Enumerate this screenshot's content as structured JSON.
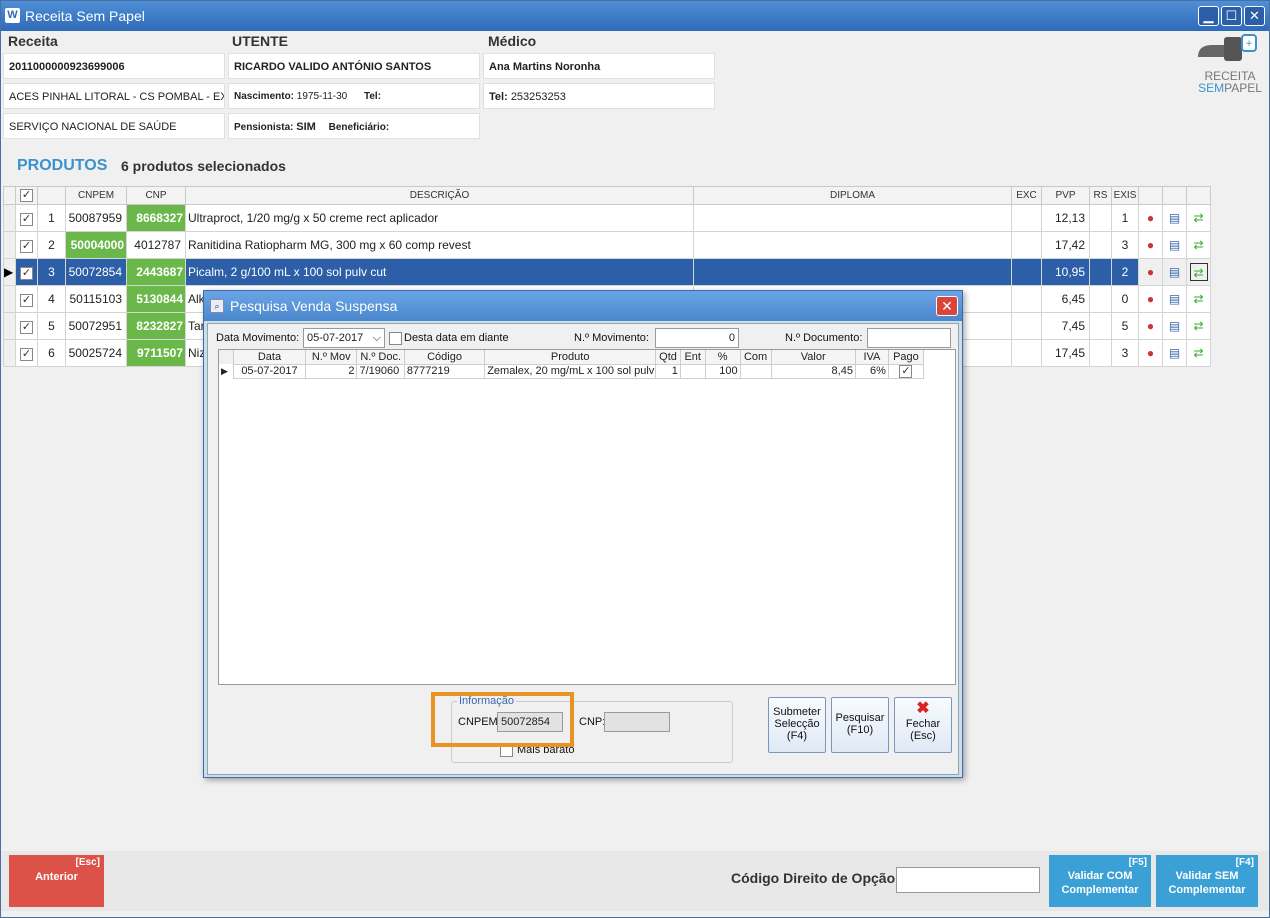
{
  "app": {
    "title": "Receita Sem Papel",
    "icon_letter": "W",
    "window_buttons": {
      "minimize": "▁",
      "maximize": "☐",
      "close": "✕"
    }
  },
  "header": {
    "receita": {
      "label": "Receita",
      "numero": "2011000000923699006",
      "local": "ACES PINHAL LITORAL - CS POMBAL - EXT",
      "entidade": "SERVIÇO NACIONAL DE SAÚDE"
    },
    "utente": {
      "label": "UTENTE",
      "nome": "RICARDO VALIDO ANTÓNIO SANTOS",
      "nascimento_label": "Nascimento:",
      "nascimento": "1975-11-30",
      "tel_label": "Tel:",
      "tel": "",
      "pensionista_label": "Pensionista:",
      "pensionista": "SIM",
      "beneficiario_label": "Beneficiário:",
      "beneficiario": ""
    },
    "medico": {
      "label": "Médico",
      "nome": "Ana Martins Noronha",
      "tel_label": "Tel:",
      "tel": "253253253"
    },
    "logo": {
      "line1": "RECEITA",
      "line2a": "SEM",
      "line2b": "PAPEL"
    }
  },
  "produtos": {
    "title": "PRODUTOS",
    "count_text": "6 produtos selecionados",
    "columns": {
      "cnpem": "CNPEM",
      "cnp": "CNP",
      "descricao": "DESCRIÇÃO",
      "diploma": "DIPLOMA",
      "exc": "EXC",
      "pvp": "PVP",
      "rs": "RS",
      "exis": "EXIS"
    },
    "rows": [
      {
        "n": "1",
        "cnpem": "50087959",
        "cnp": "8668327",
        "descricao": "Ultraproct, 1/20 mg/g x 50 creme rect aplicador",
        "pvp": "12,13",
        "exis": "1"
      },
      {
        "n": "2",
        "cnpem": "50004000",
        "cnp": "4012787",
        "descricao": "Ranitidina Ratiopharm MG, 300 mg x 60 comp revest",
        "pvp": "17,42",
        "exis": "3"
      },
      {
        "n": "3",
        "cnpem": "50072854",
        "cnp": "2443687",
        "descricao": "Picalm, 2 g/100 mL x 100 sol pulv cut",
        "pvp": "10,95",
        "exis": "2"
      },
      {
        "n": "4",
        "cnpem": "50115103",
        "cnp": "5130844",
        "descricao": "Alk",
        "pvp": "6,45",
        "exis": "0"
      },
      {
        "n": "5",
        "cnpem": "50072951",
        "cnp": "8232827",
        "descricao": "Tar",
        "pvp": "7,45",
        "exis": "5"
      },
      {
        "n": "6",
        "cnpem": "50025724",
        "cnp": "9711507",
        "descricao": "Niz",
        "pvp": "17,45",
        "exis": "3"
      }
    ]
  },
  "dialog": {
    "title": "Pesquisa Venda Suspensa",
    "data_movimento_label": "Data Movimento:",
    "data_movimento": "05-07-2017",
    "desta_data_label": "Desta data em diante",
    "n_movimento_label": "N.º Movimento:",
    "n_movimento": "0",
    "n_documento_label": "N.º Documento:",
    "n_documento": "",
    "grid": {
      "columns": {
        "data": "Data",
        "nmov": "N.º Mov",
        "ndoc": "N.º Doc.",
        "codigo": "Código",
        "produto": "Produto",
        "qtd": "Qtd",
        "ent": "Ent",
        "pct": "%",
        "com": "Com",
        "valor": "Valor",
        "iva": "IVA",
        "pago": "Pago"
      },
      "row": {
        "data": "05-07-2017",
        "nmov": "2",
        "ndoc": "7/19060",
        "codigo": "8777219",
        "produto": "Zemalex, 20 mg/mL x 100 sol pulv",
        "qtd": "1",
        "ent": "",
        "pct": "100",
        "com": "",
        "valor": "8,45",
        "iva": "6%"
      }
    },
    "info": {
      "title": "Informação",
      "cnpem_label": "CNPEM:",
      "cnpem": "50072854",
      "cnp_label": "CNP:",
      "cnp": "",
      "mais_barato": "Mais barato"
    },
    "buttons": {
      "submeter_1": "Submeter",
      "submeter_2": "Selecção",
      "submeter_3": "(F4)",
      "pesquisar_1": "Pesquisar",
      "pesquisar_2": "(F10)",
      "fechar_1": "Fechar",
      "fechar_2": "(Esc)"
    }
  },
  "footer": {
    "anterior": {
      "label": "Anterior",
      "key": "[Esc]"
    },
    "codigo_label": "Código Direito de Opção",
    "codigo_value": "",
    "validar_com": {
      "line1": "Validar COM",
      "line2": "Complementar",
      "key": "[F5]"
    },
    "validar_sem": {
      "line1": "Validar SEM",
      "line2": "Complementar",
      "key": "[F4]"
    }
  },
  "colors": {
    "accent": "#3a92d0",
    "selected_row": "#2d5ea8",
    "cnp_green": "#6ab84a",
    "btn_red": "#dd5248",
    "btn_blue": "#3aa0d5",
    "highlight": "#e89322"
  }
}
